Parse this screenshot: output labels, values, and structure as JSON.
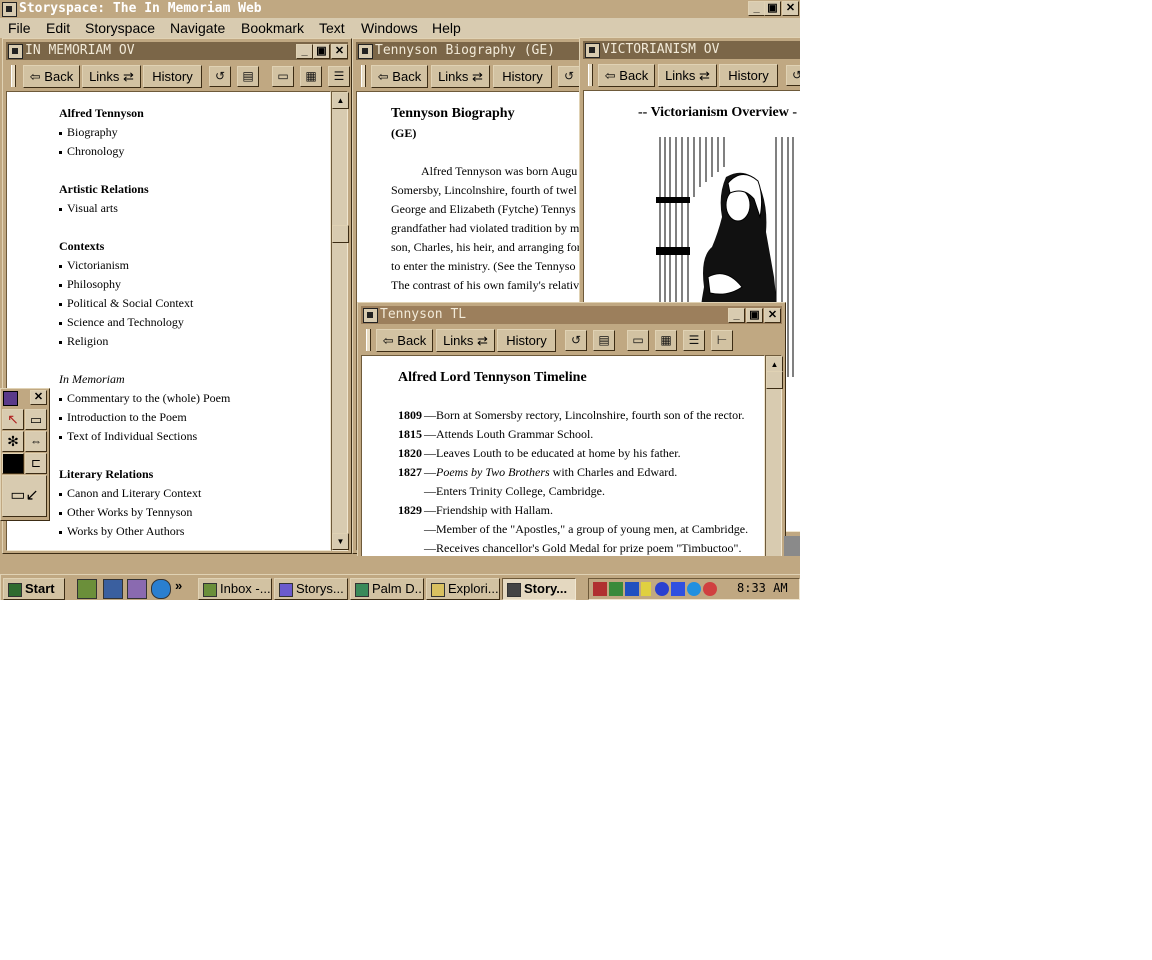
{
  "app": {
    "title": "Storyspace: The In Memoriam Web",
    "caption_buttons": {
      "minimize": "_",
      "restore": "▣",
      "close": "✕"
    }
  },
  "menu": [
    "File",
    "Edit",
    "Storyspace",
    "Navigate",
    "Bookmark",
    "Text",
    "Windows",
    "Help"
  ],
  "toolbar": {
    "back": "Back",
    "links": "Links",
    "history": "History"
  },
  "windows": {
    "overview": {
      "title": "IN MEMORIAM OV",
      "sections": [
        {
          "heading": "Alfred Tennyson",
          "italic": false,
          "items": [
            "Biography",
            "Chronology"
          ]
        },
        {
          "heading": "Artistic Relations",
          "italic": false,
          "items": [
            "Visual arts"
          ]
        },
        {
          "heading": "Contexts",
          "italic": false,
          "items": [
            "Victorianism",
            "Philosophy",
            "Political & Social Context",
            "Science and Technology",
            "Religion"
          ]
        },
        {
          "heading": "In Memoriam",
          "italic": true,
          "items": [
            "Commentary to the (whole) Poem",
            "Introduction to the Poem",
            "Text of Individual Sections"
          ]
        },
        {
          "heading": "Literary Relations",
          "italic": false,
          "items": [
            "Canon and Literary Context",
            "Other Works by Tennyson",
            "Works by Other Authors"
          ]
        }
      ]
    },
    "biography": {
      "title": "Tennyson Biography (GE)",
      "heading": "Tennyson Biography",
      "subheading": "(GE)",
      "lines": [
        "Alfred Tennyson was born Augu",
        "Somersby, Lincolnshire, fourth of twel",
        "George and Elizabeth (Fytche) Tennys",
        "grandfather had violated tradition by m",
        "son, Charles, his heir, and arranging for",
        "to enter the ministry.  (See the Tennyso",
        "The contrast of his own family's relativ"
      ]
    },
    "victorianism": {
      "title": "VICTORIANISM OV",
      "heading": "-- Victorianism Overview -"
    },
    "timeline": {
      "title": "Tennyson TL",
      "heading": "Alfred Lord Tennyson Timeline",
      "entries": [
        {
          "year": "1809",
          "text": "—Born at Somersby rectory, Lincolnshire, fourth son of the rector."
        },
        {
          "year": "1815",
          "text": "—Attends Louth Grammar School."
        },
        {
          "year": "1820",
          "text": "—Leaves Louth to be educated at home by his father."
        },
        {
          "year": "1827",
          "text": "—",
          "italic": "Poems by Two Brothers",
          "rest": " with Charles and Edward."
        },
        {
          "year": "",
          "text": "—Enters Trinity College, Cambridge."
        },
        {
          "year": "1829",
          "text": "—Friendship with Hallam."
        },
        {
          "year": "",
          "text": "—Member of the \"Apostles,\" a group of young men, at Cambridge."
        },
        {
          "year": "",
          "text": "—Receives chancellor's Gold Medal for prize poem \"Timbuctoo\"."
        }
      ]
    }
  },
  "taskbar": {
    "start": "Start",
    "tasks": [
      "Inbox -...",
      "Storys...",
      "Palm D...",
      "Explori...",
      "Story..."
    ],
    "clock": "8:33 AM"
  },
  "colors": {
    "chrome": "#c0a882",
    "title_inactive": "#7b6648",
    "title_active": "#9c7f5c"
  }
}
